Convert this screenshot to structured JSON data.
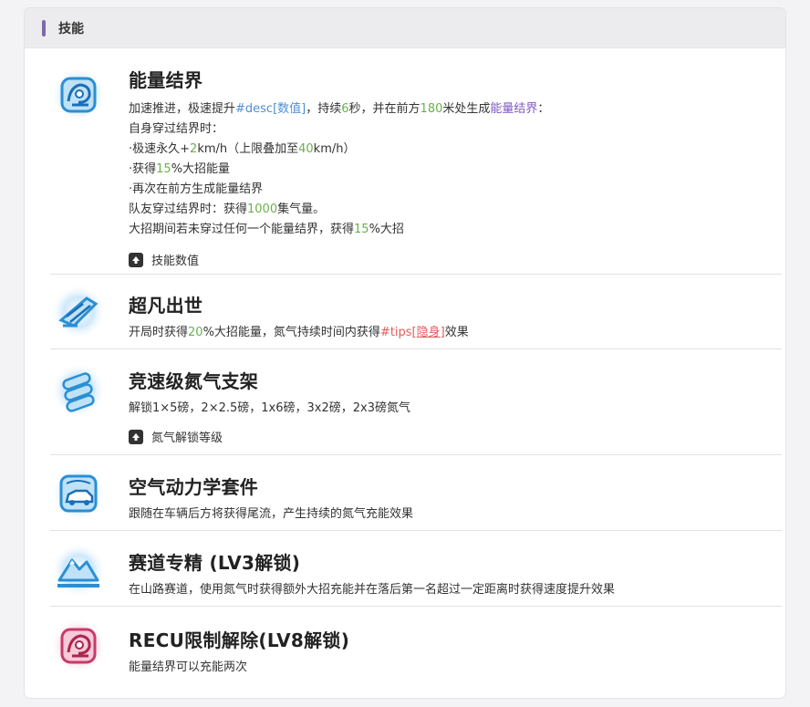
{
  "panel": {
    "title": "技能"
  },
  "colors": {
    "header_accent": "#7d6aa8",
    "number_green": "#6ab04c",
    "link_blue": "#4e8fd6",
    "link_purple": "#7e57c2",
    "tips_red": "#e35b5b"
  },
  "skills": [
    {
      "icon": "energy-barrier-icon",
      "name": "能量结界",
      "line1": {
        "a": "加速推进，极速提升",
        "b": "#desc[数值]",
        "c": "，持续",
        "d": "6",
        "e": "秒，并在前方",
        "f": "180",
        "g": "米处生成",
        "h": "能量结界",
        "i": "："
      },
      "line2": "自身穿过结界时：",
      "line3": {
        "a": "·极速永久+",
        "b": "2",
        "c": "km/h（上限叠加至",
        "d": "40",
        "e": "km/h）"
      },
      "line4": {
        "a": "·获得",
        "b": "15",
        "c": "%大招能量"
      },
      "line5": "·再次在前方生成能量结界",
      "line6": {
        "a": "队友穿过结界时：获得",
        "b": "1000",
        "c": "集气量。"
      },
      "line7": {
        "a": "大招期间若未穿过任何一个能量结界，获得",
        "b": "15",
        "c": "%大招"
      },
      "extra": "技能数值"
    },
    {
      "icon": "super-speed-icon",
      "name": "超凡出世",
      "line1": {
        "a": "开局时获得",
        "b": "20",
        "c": "%大招能量，氮气持续时间内获得",
        "d": "#tips[",
        "e": "隐身",
        "f": "]",
        "g": "效果"
      }
    },
    {
      "icon": "nitro-rack-icon",
      "name": "竞速级氮气支架",
      "line1": "解锁1×5磅，2×2.5磅，1x6磅，3x2磅，2x3磅氮气",
      "extra": "氮气解锁等级"
    },
    {
      "icon": "aero-kit-icon",
      "name": "空气动力学套件",
      "line1": "跟随在车辆后方将获得尾流，产生持续的氮气充能效果"
    },
    {
      "icon": "mountain-track-icon",
      "name": "赛道专精 (LV3解锁)",
      "line1": "在山路赛道，使用氮气时获得额外大招充能并在落后第一名超过一定距离时获得速度提升效果"
    },
    {
      "icon": "recu-unlock-icon",
      "name": "RECU限制解除(LV8解锁)",
      "line1": "能量结界可以充能两次"
    }
  ]
}
